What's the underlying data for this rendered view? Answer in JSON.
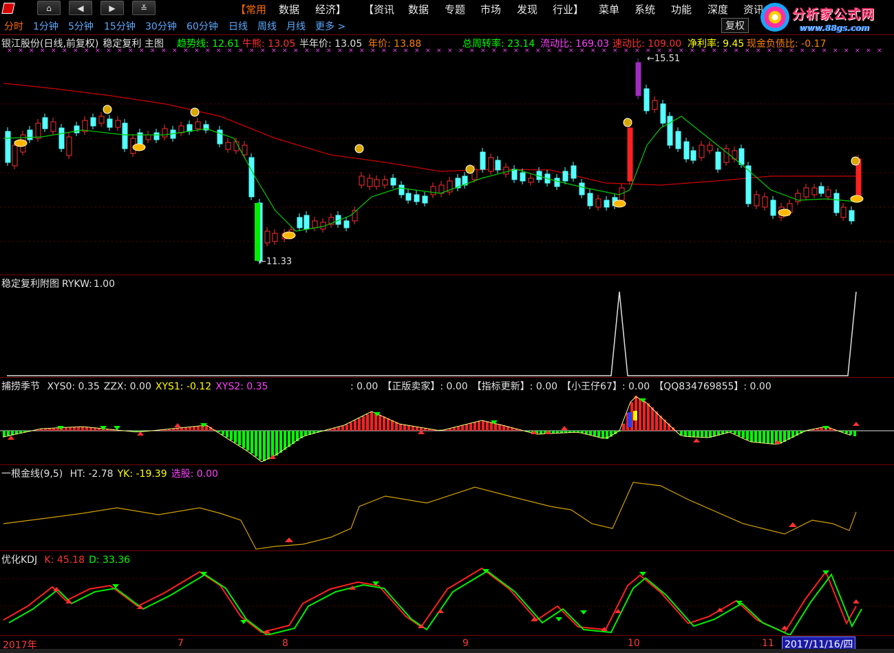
{
  "toolbar": {
    "menus": [
      "【常用",
      "数据",
      "经济】",
      "【资讯",
      "数据",
      "专题",
      "市场",
      "发现",
      "行业】",
      "菜单",
      "系统",
      "功能",
      "深度",
      "资讯"
    ]
  },
  "brand": {
    "title": "分析家公式网",
    "url": "www.88gs.com"
  },
  "periods": [
    "分时",
    "1分钟",
    "5分钟",
    "15分钟",
    "30分钟",
    "60分钟",
    "日线",
    "周线",
    "月线",
    "更多 >"
  ],
  "fuquan_label": "复权",
  "main_panel": {
    "stock": "银江股份(日线,前复权)",
    "indicator": "稳定复利 主图",
    "items": [
      {
        "label": "趋势线:",
        "value": "12.61",
        "color": "#00ff00"
      },
      {
        "label": "牛熊:",
        "value": "13.05",
        "color": "#ff3030"
      },
      {
        "label": "半年价:",
        "value": "13.05",
        "color": "#e0e0e0"
      },
      {
        "label": "年价:",
        "value": "13.88",
        "color": "#ff8000"
      },
      {
        "label": "总周转率:",
        "value": "23.14",
        "color": "#00ff00"
      },
      {
        "label": "流动比:",
        "value": "169.03",
        "color": "#ff40ff"
      },
      {
        "label": "速动比:",
        "value": "109.00",
        "color": "#ff3030"
      },
      {
        "label": "净利率:",
        "value": "9.45",
        "color": "#ffff00"
      },
      {
        "label": "现金负债比:",
        "value": "-0.17",
        "color": "#ff8000"
      }
    ],
    "high_label": "15.51",
    "low_label": "11.33"
  },
  "sub1": {
    "title": "稳定复利附图",
    "label": "RYKW:",
    "value": "1.00"
  },
  "sub2": {
    "title": "捕捞季节",
    "items": [
      {
        "label": "XYS0:",
        "value": "0.35",
        "color": "#e0e0e0"
      },
      {
        "label": "ZZX:",
        "value": "0.00",
        "color": "#e0e0e0"
      },
      {
        "label": "XYS1:",
        "value": "-0.12",
        "color": "#ffff00"
      },
      {
        "label": "XYS2:",
        "value": "0.35",
        "color": "#ff40ff"
      }
    ],
    "ads": [
      ": 0.00",
      "【正版卖家】: 0.00",
      "【指标更新】: 0.00",
      "【小王仔67】: 0.00",
      "【QQ834769855】: 0.00"
    ]
  },
  "sub3": {
    "title": "一根金线(9,5)",
    "items": [
      {
        "label": "HT:",
        "value": "-2.78",
        "color": "#e0e0e0"
      },
      {
        "label": "YK:",
        "value": "-19.39",
        "color": "#ffff00"
      },
      {
        "label": "选股:",
        "value": "0.00",
        "color": "#ff40ff"
      }
    ]
  },
  "sub4": {
    "title": "优化KDJ",
    "items": [
      {
        "label": "K:",
        "value": "45.18",
        "color": "#ff3030"
      },
      {
        "label": "D:",
        "value": "33.36",
        "color": "#00ff00"
      }
    ]
  },
  "axis": {
    "dates": [
      "2017年",
      "7",
      "8",
      "9",
      "10",
      "11"
    ],
    "cursor_date": "2017/11/16/四"
  },
  "colors": {
    "up": "#ff3030",
    "down": "#54ffff",
    "ma": "#00cc00",
    "longma": "#cc0000",
    "gold": "#d4a000"
  }
}
